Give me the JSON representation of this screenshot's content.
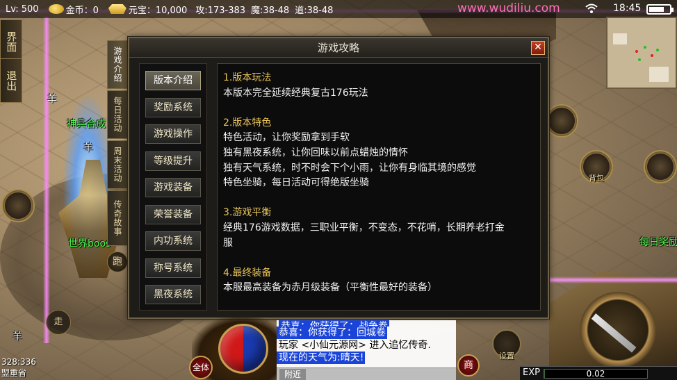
{
  "status_bar": {
    "level": "Lv: 500",
    "gold": "金币：0",
    "yuanbao": "元宝：10,000",
    "attack": "攻:173-383",
    "magic": "魔:38-48",
    "tao": "道:38-48",
    "website": "www.wudiliu.com",
    "time": "18:45",
    "battery_level": 0.7
  },
  "side_buttons": [
    "界面",
    "退出"
  ],
  "map_labels": {
    "sheep_1": "羊",
    "sheep_2": "羊",
    "sheep_3": "羊",
    "npc_shenbing": "神兵合成",
    "npc_world_boss": "世界boos",
    "npc_daily_reward": "每日奖励"
  },
  "vertical_tabs": [
    "游戏介绍",
    "每日活动",
    "周末活动",
    "传奇故事"
  ],
  "dialog": {
    "title": "游戏攻略",
    "close": "✕",
    "menu": [
      "版本介绍",
      "奖励系统",
      "游戏操作",
      "等级提升",
      "游戏装备",
      "荣誉装备",
      "内功系统",
      "称号系统",
      "黑夜系统"
    ],
    "active_menu_index": 0,
    "sections": [
      {
        "title": "1.版本玩法",
        "lines": [
          "本版本完全延续经典复古176玩法"
        ]
      },
      {
        "title": "2.版本特色",
        "lines": [
          "特色活动，让你奖励拿到手软",
          "独有黑夜系统，让你回味以前点蜡烛的情怀",
          "独有天气系统，时不时会下个小雨，让你有身临其境的感觉",
          "特色坐骑，每日活动可得绝版坐骑"
        ]
      },
      {
        "title": "3.游戏平衡",
        "lines": [
          "经典176游戏数据，三职业平衡，不变态，不花哨，长期养老打金",
          "服"
        ]
      },
      {
        "title": "4.最终装备",
        "lines": [
          "本服最高装备为赤月级装备（平衡性最好的装备）"
        ]
      }
    ]
  },
  "controls": {
    "run": "跑",
    "walk": "走",
    "mode": "全体",
    "shop": "商",
    "settings": "设置",
    "backpack": "背包"
  },
  "chat": {
    "lines": [
      {
        "text": "恭喜：你获得了：战争卷",
        "highlight": true,
        "partial": true
      },
      {
        "text": "恭喜：你获得了：回城卷",
        "highlight": true,
        "partial": false
      },
      {
        "text": "玩家 <小仙元源网> 进入追忆传奇.",
        "highlight": false,
        "partial": false
      },
      {
        "text": "现在的天气为:晴天!",
        "highlight": true,
        "partial": false
      }
    ],
    "tab": "附近"
  },
  "exp": {
    "label": "EXP",
    "value": "0.02",
    "fraction": 0.0002
  },
  "location": {
    "coords": "328:336",
    "map_name": "盟重省"
  },
  "colors": {
    "section_title": "#e6c25a",
    "website": "#ff70b8",
    "npc_label": "#4fff4f",
    "chat_highlight": "#1a44d8"
  }
}
